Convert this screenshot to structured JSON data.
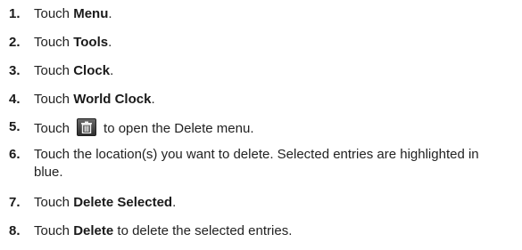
{
  "steps": [
    {
      "number": "1.",
      "prefix": "Touch ",
      "bold": "Menu",
      "suffix": "."
    },
    {
      "number": "2.",
      "prefix": "Touch ",
      "bold": "Tools",
      "suffix": "."
    },
    {
      "number": "3.",
      "prefix": "Touch ",
      "bold": "Clock",
      "suffix": "."
    },
    {
      "number": "4.",
      "prefix": "Touch ",
      "bold": "World Clock",
      "suffix": "."
    },
    {
      "number": "5.",
      "prefix": "Touch",
      "icon": "trash-icon",
      "suffix": "to open the Delete menu."
    },
    {
      "number": "6.",
      "text_line1": "Touch the location(s) you want to delete. Selected entries are highlighted in",
      "text_line2": "blue."
    },
    {
      "number": "7.",
      "prefix": "Touch ",
      "bold": "Delete Selected",
      "suffix": "."
    },
    {
      "number": "8.",
      "prefix": "Touch ",
      "bold": "Delete",
      "suffix": " to delete the selected entries."
    }
  ]
}
